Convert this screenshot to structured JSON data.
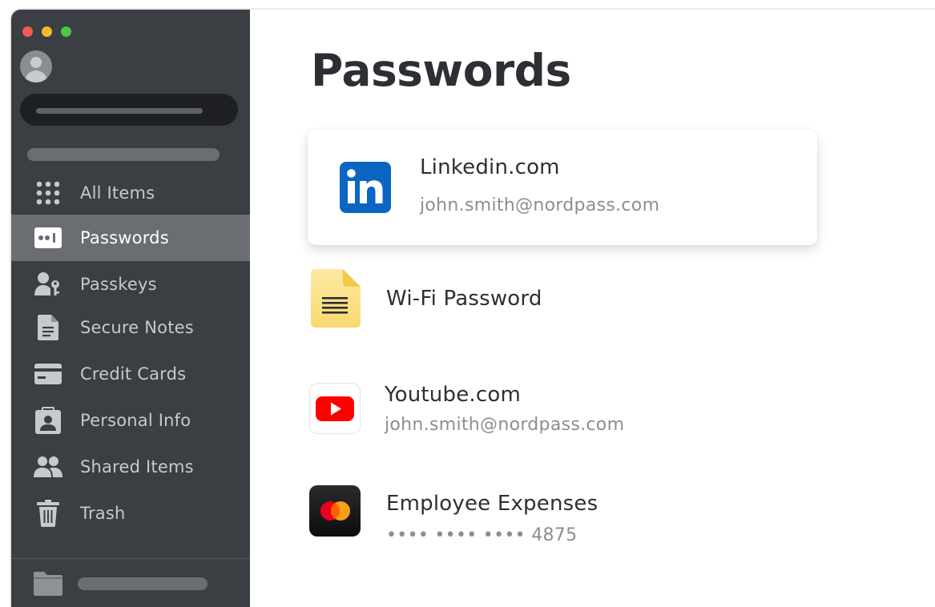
{
  "page": {
    "title": "Passwords"
  },
  "sidebar": {
    "items": [
      {
        "label": "All Items",
        "icon": "grid-icon",
        "active": false
      },
      {
        "label": "Passwords",
        "icon": "password-icon",
        "active": true
      },
      {
        "label": "Passkeys",
        "icon": "passkey-icon",
        "active": false
      },
      {
        "label": "Secure Notes",
        "icon": "note-icon",
        "active": false
      },
      {
        "label": "Credit Cards",
        "icon": "credit-card-icon",
        "active": false
      },
      {
        "label": "Personal Info",
        "icon": "id-card-icon",
        "active": false
      },
      {
        "label": "Shared Items",
        "icon": "people-icon",
        "active": false
      },
      {
        "label": "Trash",
        "icon": "trash-icon",
        "active": false
      }
    ]
  },
  "items": [
    {
      "title": "Linkedin.com",
      "subtitle": "john.smith@nordpass.com",
      "icon": "linkedin-icon",
      "selected": true
    },
    {
      "title": "Wi-Fi Password",
      "subtitle": "",
      "icon": "note-icon",
      "selected": false
    },
    {
      "title": "Youtube.com",
      "subtitle": "john.smith@nordpass.com",
      "icon": "youtube-icon",
      "selected": false
    },
    {
      "title": "Employee Expenses",
      "subtitle": "•••• •••• •••• 4875",
      "icon": "mastercard-icon",
      "selected": false
    }
  ],
  "colors": {
    "sidebar_bg": "#3b3e43",
    "sidebar_active": "#6a6d72",
    "linkedin_blue": "#0a66c2",
    "youtube_red": "#ff0000",
    "note_yellow": "#fbe08a"
  }
}
